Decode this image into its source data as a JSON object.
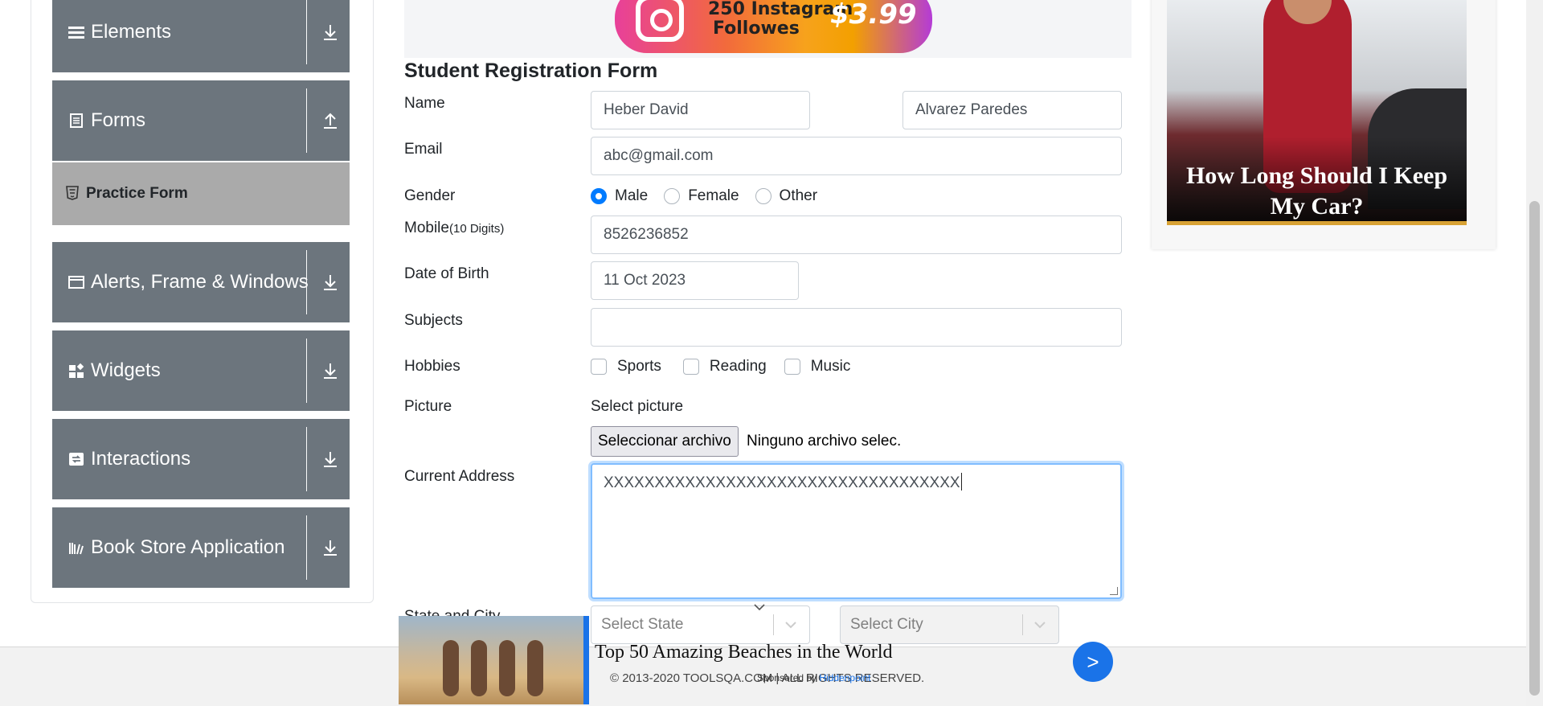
{
  "sidebar": {
    "groups": [
      {
        "label": "Elements",
        "icon": "list-icon",
        "arrow": "download-arrow-icon"
      },
      {
        "label": "Forms",
        "icon": "document-icon",
        "arrow": "upload-arrow-icon"
      },
      {
        "label": "Alerts, Frame & Windows",
        "icon": "window-icon",
        "arrow": "download-arrow-icon"
      },
      {
        "label": "Widgets",
        "icon": "widgets-icon",
        "arrow": "download-arrow-icon"
      },
      {
        "label": "Interactions",
        "icon": "interactions-icon",
        "arrow": "download-arrow-icon"
      },
      {
        "label": "Book Store Application",
        "icon": "books-icon",
        "arrow": "download-arrow-icon"
      }
    ],
    "active_item": {
      "label": "Practice Form",
      "icon": "html5-icon"
    }
  },
  "top_banner": {
    "line1": "250 Instagram",
    "line2": "Followes",
    "price": "$3.99"
  },
  "form": {
    "title": "Student Registration Form",
    "name_label": "Name",
    "first_name": "Heber David",
    "last_name": "Alvarez Paredes",
    "email_label": "Email",
    "email": "abc@gmail.com",
    "gender_label": "Gender",
    "gender_options": [
      "Male",
      "Female",
      "Other"
    ],
    "gender_selected": "Male",
    "mobile_label": "Mobile",
    "mobile_hint": "(10 Digits)",
    "mobile": "8526236852",
    "dob_label": "Date of Birth",
    "dob": "11 Oct 2023",
    "subjects_label": "Subjects",
    "subjects": "",
    "hobbies_label": "Hobbies",
    "hobbies": [
      "Sports",
      "Reading",
      "Music"
    ],
    "picture_label": "Picture",
    "select_picture": "Select picture",
    "file_button": "Seleccionar archivo",
    "file_status": "Ninguno archivo selec.",
    "address_label": "Current Address",
    "address": "XXXXXXXXXXXXXXXXXXXXXXXXXXXXXXXXXXX",
    "state_city_label": "State and City",
    "state_placeholder": "Select State",
    "city_placeholder": "Select City"
  },
  "side_ad": {
    "caption_line1": "How Long Should I Keep",
    "caption_line2": "My Car?"
  },
  "bottom_ad": {
    "title": "Top 50 Amazing Beaches in the World",
    "sponsor_prefix": "Sponsored by",
    "sponsor": "Hiddenpoint",
    "go": ">"
  },
  "footer": {
    "text": "© 2013-2020 TOOLSQA.COM | ALL RIGHTS RESERVED."
  },
  "colors": {
    "sidebar": "#6c757d",
    "active_item": "#aaaaaa",
    "accent": "#007bff",
    "ad_blue": "#1a73e8"
  }
}
